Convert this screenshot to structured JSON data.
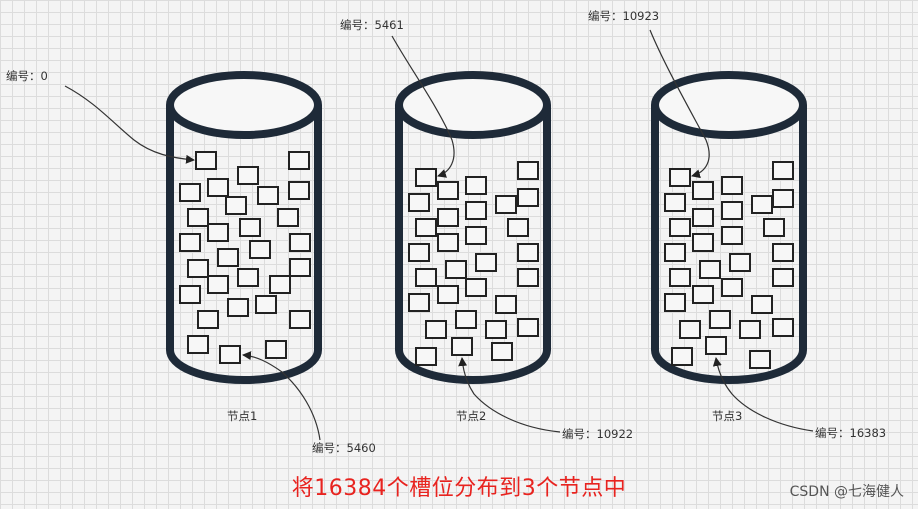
{
  "caption": "将16384个槽位分布到3个节点中",
  "watermark": "CSDN @七海健人",
  "nodes": [
    {
      "name": "节点1",
      "first_slot": "编号：0",
      "last_slot": "编号：5460"
    },
    {
      "name": "节点2",
      "first_slot": "编号：5461",
      "last_slot": "编号：10922"
    },
    {
      "name": "节点3",
      "first_slot": "编号：10923",
      "last_slot": "编号：16383"
    }
  ],
  "colors": {
    "cylinder": "#1e2a38",
    "caption": "#e8231f",
    "arrow": "#333333"
  }
}
